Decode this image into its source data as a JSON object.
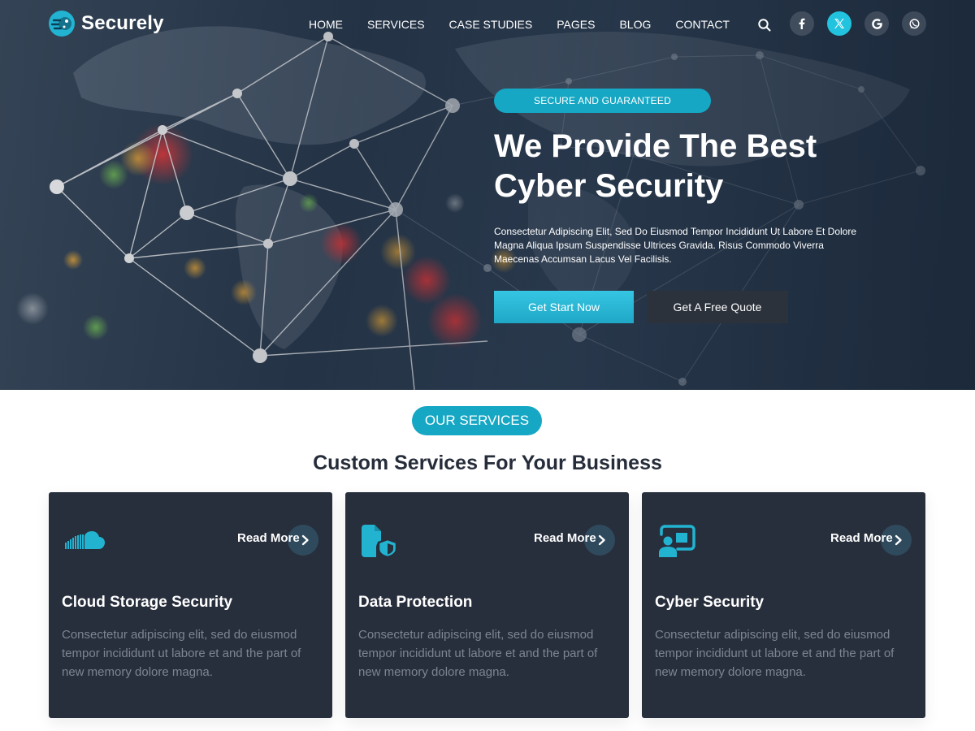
{
  "brand": {
    "name": "Securely",
    "accent": "#15a7c4",
    "dark_card": "#272e3c"
  },
  "nav": {
    "items": [
      "HOME",
      "SERVICES",
      "CASE STUDIES",
      "PAGES",
      "BLOG",
      "CONTACT"
    ],
    "icons": [
      "search-icon",
      "facebook-icon",
      "x-twitter-icon",
      "google-icon",
      "whatsapp-icon"
    ]
  },
  "hero": {
    "badge": "SECURE AND GUARANTEED",
    "title_line1": "We Provide The Best",
    "title_line2": "Cyber Security",
    "description": "Consectetur Adipiscing Elit, Sed Do Eiusmod Tempor Incididunt Ut Labore Et Dolore Magna Aliqua Ipsum Suspendisse Ultrices Gravida. Risus Commodo Viverra Maecenas Accumsan Lacus Vel Facilisis.",
    "primary_button": "Get Start Now",
    "secondary_button": "Get A Free Quote"
  },
  "services": {
    "pill": "OUR SERVICES",
    "title": "Custom Services For Your Business",
    "cards": [
      {
        "icon": "cloud-icon",
        "read_more": "Read More",
        "title": "Cloud Storage Security",
        "description": "Consectetur adipiscing elit, sed do eiusmod tempor incididunt ut labore et and the part of new memory dolore magna."
      },
      {
        "icon": "shield-document-icon",
        "read_more": "Read More",
        "title": "Data Protection",
        "description": "Consectetur adipiscing elit, sed do eiusmod tempor incididunt ut labore et and the part of new memory dolore magna."
      },
      {
        "icon": "monitor-user-icon",
        "read_more": "Read More",
        "title": "Cyber Security",
        "description": "Consectetur adipiscing elit, sed do eiusmod tempor incididunt ut labore et and the part of new memory dolore magna."
      }
    ]
  }
}
